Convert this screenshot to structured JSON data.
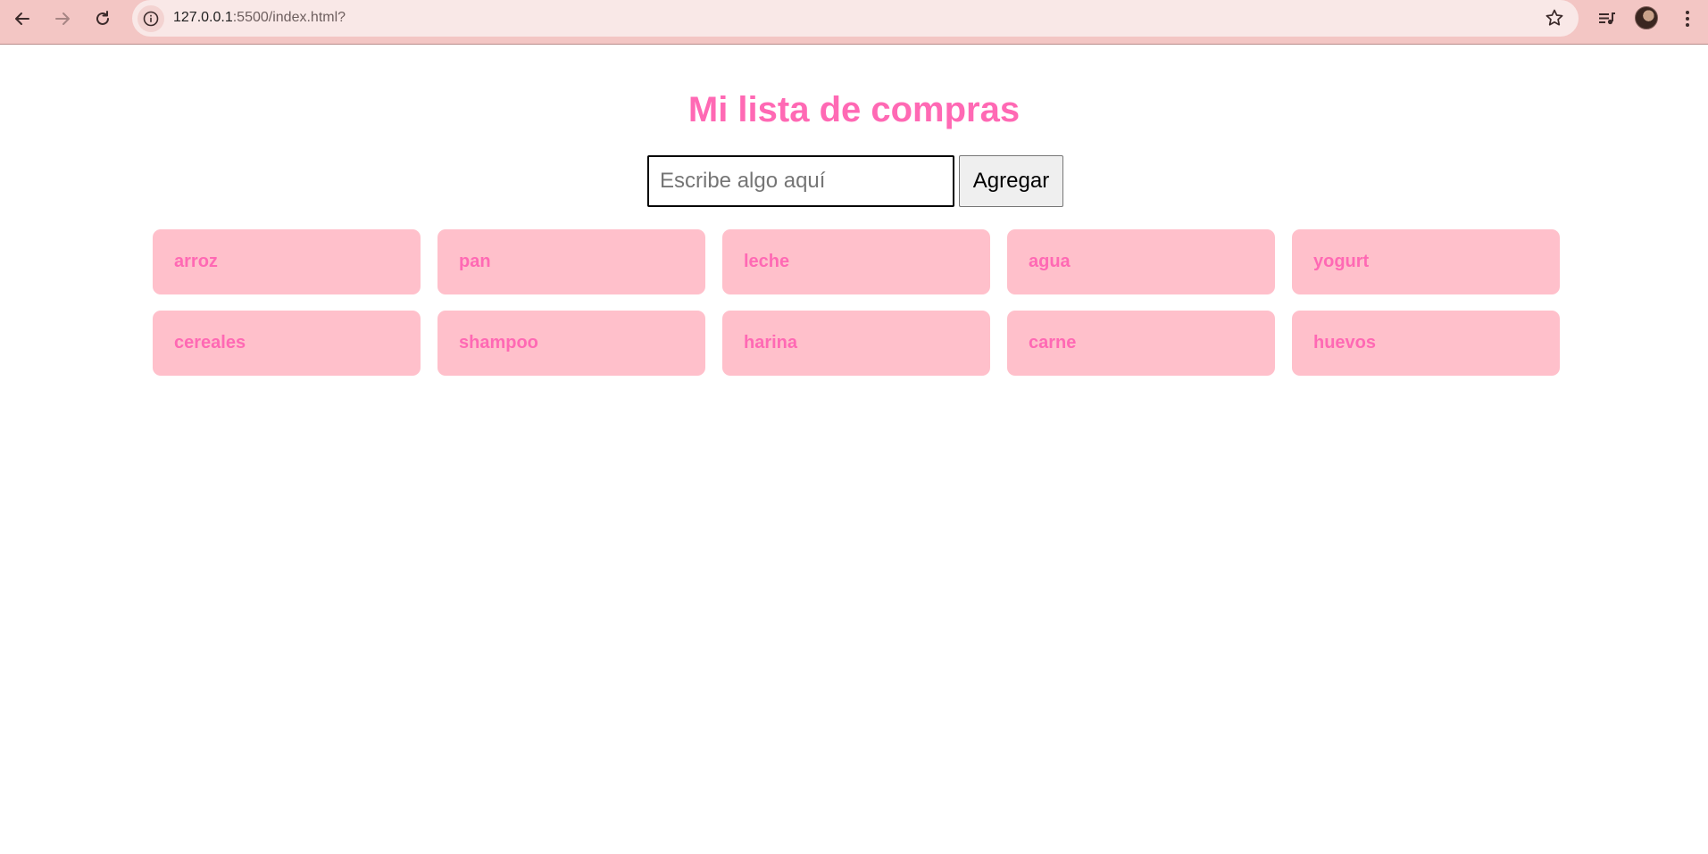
{
  "browser": {
    "url_host": "127.0.0.1",
    "url_path": ":5500/index.html?"
  },
  "page": {
    "title": "Mi lista de compras",
    "input_placeholder": "Escribe algo aquí",
    "input_value": "",
    "add_button_label": "Agregar"
  },
  "items": [
    "arroz",
    "pan",
    "leche",
    "agua",
    "yogurt",
    "cereales",
    "shampoo",
    "harina",
    "carne",
    "huevos"
  ],
  "colors": {
    "accent": "#ff69b4",
    "item_background": "#ffc0cb",
    "chrome_background": "#f3c6c4"
  },
  "icons": {
    "back": "arrow-left-icon",
    "forward": "arrow-right-icon",
    "reload": "reload-icon",
    "site_info": "info-icon",
    "bookmark": "star-icon",
    "media": "media-queue-icon",
    "menu": "kebab-menu-icon"
  }
}
